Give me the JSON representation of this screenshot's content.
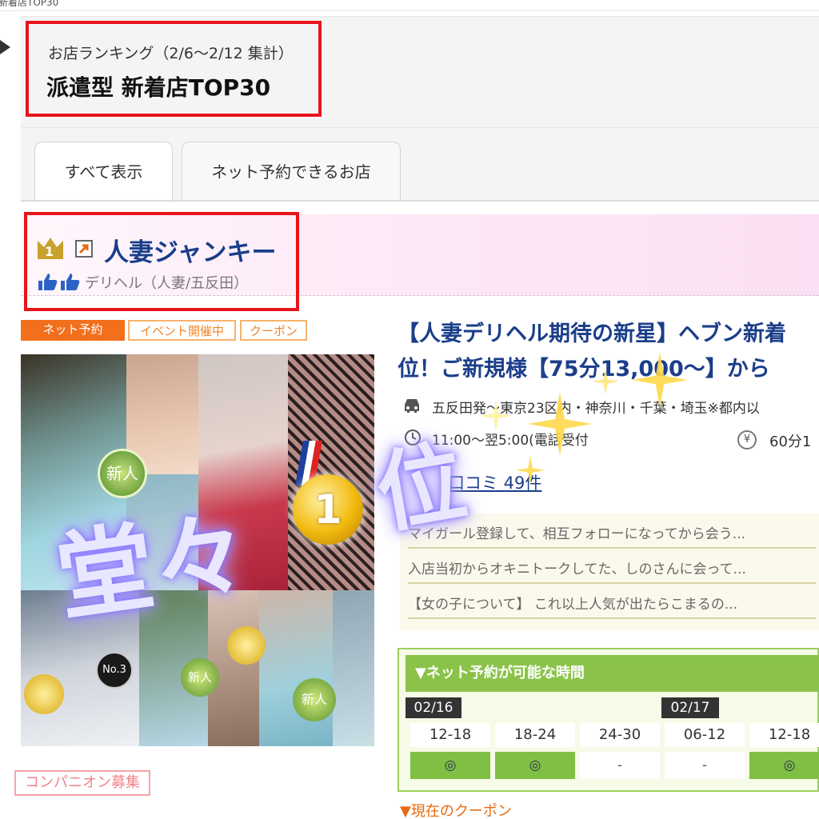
{
  "top_strip": {
    "text": "新着店TOP30"
  },
  "ranking": {
    "subtitle": "お店ランキング（2/6〜2/12 集計）",
    "title": "派遣型 新着店TOP30"
  },
  "tabs": [
    {
      "label": "すべて表示",
      "active": true
    },
    {
      "label": "ネット予約できるお店",
      "active": false
    }
  ],
  "shop": {
    "rank": "1",
    "name": "人妻ジャンキー",
    "genre": "デリヘル（人妻/五反田）",
    "badges": [
      "ネット予約",
      "イベント開催中",
      "クーポン"
    ],
    "companion_label": "コンパニオン募集",
    "headline_line1": "【人妻デリヘル期待の新星】ヘブン新着",
    "headline_line2": "位！ご新規様【75分13,000〜】から",
    "area": "五反田発〜東京23区内・神奈川・千葉・埼玉※都内以",
    "hours": "11:00〜翌5:00(電話受付",
    "price": "60分1",
    "reviews_link": "口コミ 49件",
    "reviews": [
      "マイガール登録して、相互フォローになってから会う...",
      "入店当初からオキニトークしてた、しのさんに会って...",
      "【女の子について】 これ以上人気が出たらこまるの..."
    ],
    "photo_labels": {
      "new": "新人",
      "medal_rank": "1",
      "no3": "No.3"
    }
  },
  "reservation": {
    "header": "▼ネット予約が可能な時間",
    "dates": [
      "02/16",
      "02/17"
    ],
    "slots": [
      "12-18",
      "18-24",
      "24-30",
      "06-12",
      "12-18"
    ],
    "marks": [
      "◎",
      "◎",
      "-",
      "-",
      "◎"
    ]
  },
  "coupon_link": "▼現在のクーポン",
  "overlay": {
    "text1": "堂々",
    "text2": "位"
  },
  "colors": {
    "accent_red": "#e8141b",
    "shop_blue": "#1b3e8a",
    "orange": "#f26f1c",
    "green": "#8bc34a"
  }
}
